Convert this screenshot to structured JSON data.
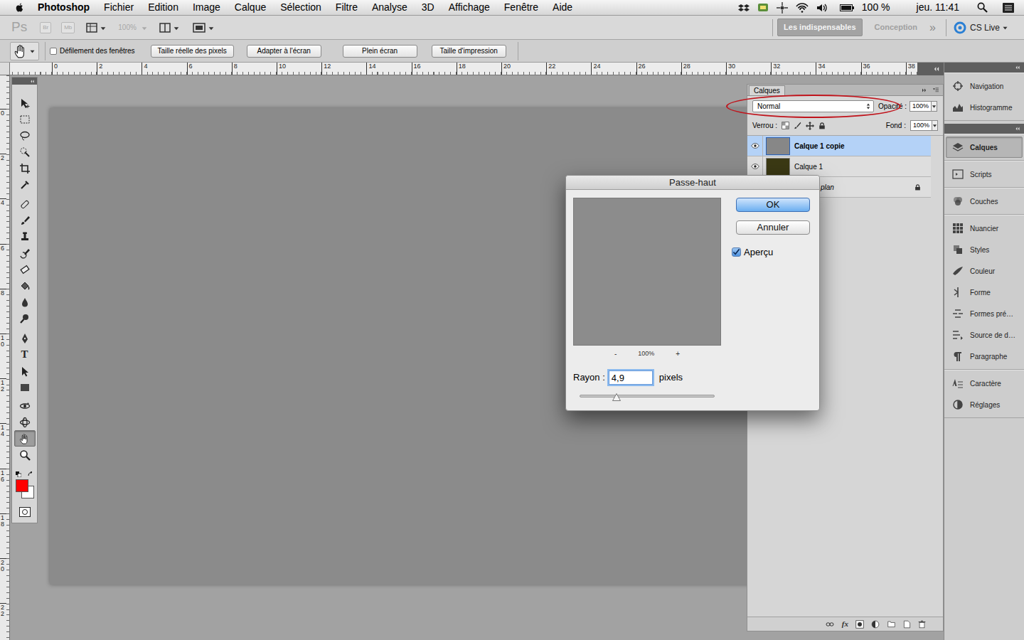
{
  "menubar": {
    "app": "Photoshop",
    "items": [
      "Fichier",
      "Edition",
      "Image",
      "Calque",
      "Sélection",
      "Filtre",
      "Analyse",
      "3D",
      "Affichage",
      "Fenêtre",
      "Aide"
    ],
    "battery": "100 %",
    "clock": "jeu. 11:41"
  },
  "appbar": {
    "logo": "Ps",
    "bridge": "Br",
    "mini_bridge": "Mb",
    "zoom": "100%",
    "workspaces": [
      {
        "label": "Les indispensables",
        "selected": true
      },
      {
        "label": "Conception",
        "selected": false
      }
    ],
    "more": "»",
    "cs_live": "CS Live"
  },
  "options_bar": {
    "scroll_all": {
      "label": "Défilement des fenêtres",
      "checked": false
    },
    "buttons": [
      "Taille réelle des pixels",
      "Adapter à l'écran",
      "Plein écran",
      "Taille d'impression"
    ]
  },
  "rulers": {
    "top": [
      "0",
      "2",
      "4",
      "6",
      "8",
      "10",
      "12",
      "14",
      "16",
      "18",
      "20",
      "22",
      "24",
      "26",
      "28",
      "30",
      "32",
      "34",
      "36",
      "38"
    ],
    "left": [
      "0",
      "2",
      "4",
      "6",
      "8",
      "10",
      "12",
      "14",
      "16",
      "18",
      "20",
      "22"
    ]
  },
  "tools": {
    "items": [
      {
        "selected": false
      },
      {
        "selected": false
      },
      {
        "selected": false
      },
      {
        "selected": false
      },
      {
        "selected": false
      },
      {
        "selected": false
      },
      {
        "selected": false
      },
      {
        "selected": false
      },
      {
        "selected": false
      },
      {
        "selected": false
      },
      {
        "selected": false
      },
      {
        "selected": false
      },
      {
        "selected": false
      },
      {
        "selected": false
      },
      {
        "selected": false
      },
      {
        "label": "T",
        "selected": false
      },
      {
        "selected": false
      },
      {
        "selected": false
      },
      {
        "selected": false
      },
      {
        "selected": false
      },
      {
        "selected": true
      },
      {
        "selected": false
      }
    ],
    "swatches": [
      {
        "color": "#ff0000"
      },
      {
        "color": "#ffffff"
      }
    ]
  },
  "layers_panel": {
    "tab": "Calques",
    "blend_mode": "Normal",
    "opacity_label": "Opacité :",
    "opacity": "100%",
    "lock_label": "Verrou :",
    "fill_label": "Fond :",
    "fill": "100%",
    "layers": [
      {
        "name": "Calque 1 copie",
        "kind": "layer",
        "visible": true,
        "selected": true,
        "color": "#878787"
      },
      {
        "name": "Calque 1",
        "kind": "layer",
        "visible": true,
        "selected": false,
        "color": "#3b3914"
      },
      {
        "name": "plan",
        "kind": "background",
        "selected": false,
        "color": "#3b3914"
      }
    ],
    "fx": "fx"
  },
  "dock": {
    "columns": [
      [
        [
          {
            "label": "Navigation",
            "selected": false
          },
          {
            "label": "Histogramme",
            "selected": false
          }
        ]
      ],
      [
        [
          {
            "label": "Calques",
            "selected": true
          }
        ],
        [
          {
            "label": "Scripts",
            "selected": false
          }
        ],
        [
          {
            "label": "Couches",
            "selected": false
          }
        ],
        [
          {
            "label": "Nuancier",
            "selected": false
          },
          {
            "label": "Styles",
            "selected": false
          },
          {
            "label": "Couleur",
            "selected": false
          },
          {
            "label": "Forme",
            "selected": false
          },
          {
            "label": "Formes pré…",
            "selected": false
          },
          {
            "label": "Source de d…",
            "selected": false
          },
          {
            "label": "Paragraphe",
            "selected": false
          }
        ],
        [
          {
            "label": "Caractère",
            "selected": false
          },
          {
            "label": "Réglages",
            "selected": false
          }
        ]
      ]
    ]
  },
  "dialog": {
    "title": "Passe-haut",
    "ok": "OK",
    "cancel": "Annuler",
    "preview": {
      "label": "Aperçu",
      "checked": true
    },
    "zoom_out": "-",
    "zoom": "100%",
    "zoom_in": "+",
    "radius_label": "Rayon :",
    "radius": "4,9",
    "unit": "pixels",
    "slider": {
      "level": 0.27
    }
  }
}
